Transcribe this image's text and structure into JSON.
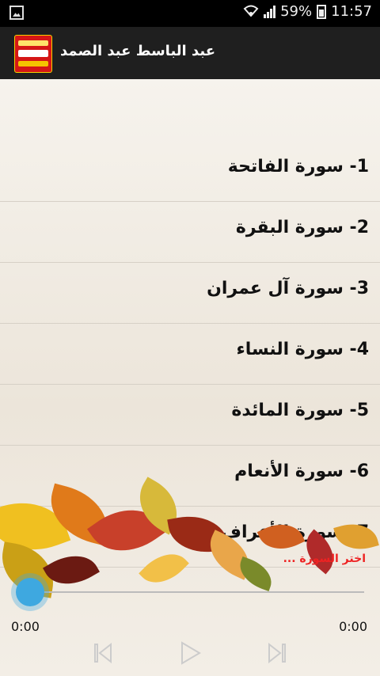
{
  "status_bar": {
    "battery": "59%",
    "time": "11:57"
  },
  "app": {
    "title": "عبد الباسط عبد الصمد"
  },
  "surahs": [
    {
      "label": "1- سورة الفاتحة"
    },
    {
      "label": "2- سورة البقرة"
    },
    {
      "label": "3- سورة آل عمران"
    },
    {
      "label": "4- سورة النساء"
    },
    {
      "label": "5- سورة المائدة"
    },
    {
      "label": "6- سورة الأنعام"
    },
    {
      "label": "7- سورة الأعراف"
    }
  ],
  "player": {
    "prompt": "اختر السورة ...",
    "elapsed": "0:00",
    "duration": "0:00",
    "progress": 0
  },
  "colors": {
    "prompt": "#e22222",
    "knob": "#3ea8e0",
    "appbar": "#1f1f1f"
  }
}
